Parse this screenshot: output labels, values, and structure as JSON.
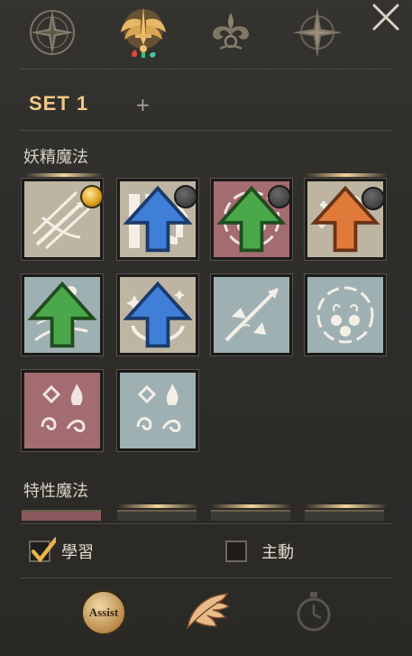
{
  "set": {
    "title": "SET 1",
    "add_label": "+"
  },
  "sections": {
    "fairy_magic": "妖精魔法",
    "trait_magic": "特性魔法"
  },
  "options": {
    "learn_label": "學習",
    "learn_checked": true,
    "active_label": "主動",
    "active_checked": false
  },
  "bottom_bar": {
    "assist_label": "Assist"
  },
  "skills": [
    {
      "id": 1,
      "theme": "tan",
      "badge": "gold",
      "arrow": "none"
    },
    {
      "id": 2,
      "theme": "tan",
      "badge": "gray",
      "arrow": "blue"
    },
    {
      "id": 3,
      "theme": "red",
      "badge": "gray",
      "arrow": "green"
    },
    {
      "id": 4,
      "theme": "tan",
      "badge": "gray",
      "arrow": "orange"
    },
    {
      "id": 5,
      "theme": "blue",
      "badge": "none",
      "arrow": "green"
    },
    {
      "id": 6,
      "theme": "tan",
      "badge": "none",
      "arrow": "blue"
    },
    {
      "id": 7,
      "theme": "blue",
      "badge": "none",
      "arrow": "none"
    },
    {
      "id": 8,
      "theme": "blue",
      "badge": "none",
      "arrow": "none"
    },
    {
      "id": 9,
      "theme": "red",
      "badge": "none",
      "arrow": "none"
    },
    {
      "id": 10,
      "theme": "blue",
      "badge": "none",
      "arrow": "none"
    }
  ],
  "colors": {
    "accent_gold": "#f0c888",
    "tan_tile": "#bdb5a2",
    "red_tile": "#a36c70",
    "blue_tile": "#9fb0b3"
  },
  "icons": [
    "compass-star-icon",
    "winged-sword-icon",
    "fleur-ornament-icon",
    "compass-rose-icon",
    "close-icon",
    "assist-icon",
    "wing-icon",
    "stopwatch-icon"
  ]
}
